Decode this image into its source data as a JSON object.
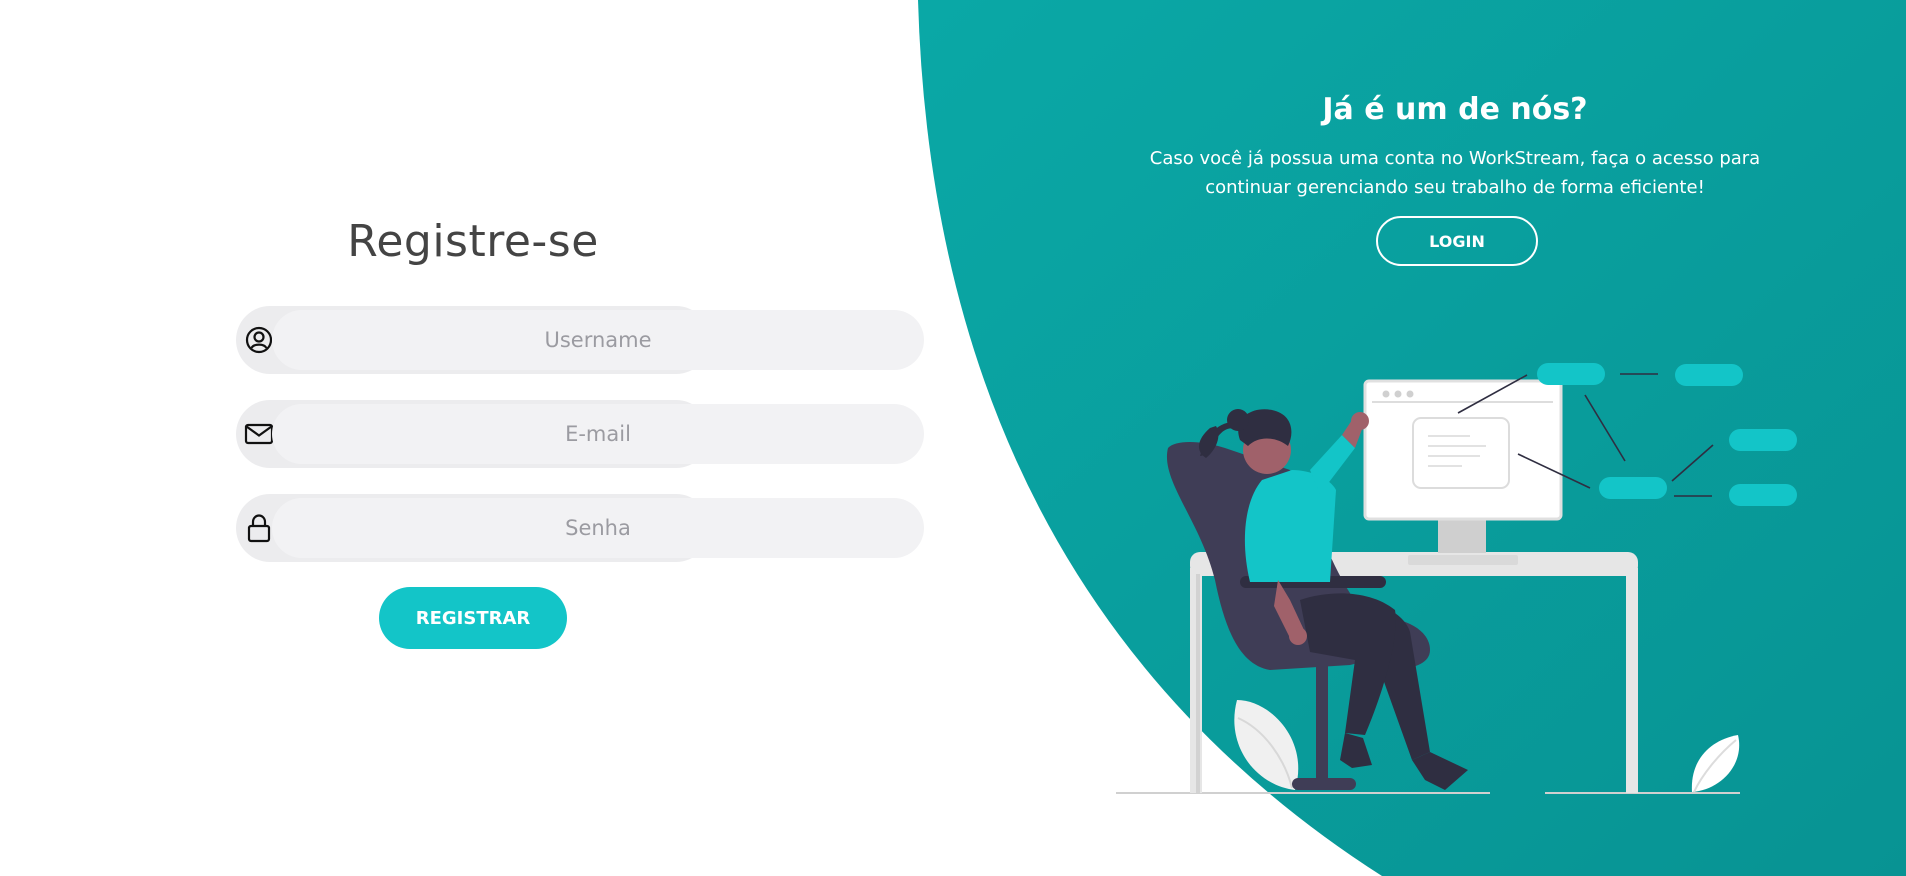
{
  "register": {
    "title": "Registre-se",
    "fields": [
      {
        "icon": "user-circle-icon",
        "placeholder": "Username",
        "value": ""
      },
      {
        "icon": "envelope-icon",
        "placeholder": "E-mail",
        "value": ""
      },
      {
        "icon": "lock-icon",
        "placeholder": "Senha",
        "value": ""
      }
    ],
    "button_label": "REGISTRAR"
  },
  "panel": {
    "title": "Já é um de nós?",
    "text": "Caso você já possua uma conta no WorkStream, faça o acesso para continuar gerenciando seu trabalho de forma eficiente!",
    "button_label": "LOGIN"
  },
  "colors": {
    "accent": "#13c5c8",
    "panel": "#0b9c9c",
    "panel_light": "#0aa6a6",
    "text_dark": "#444444",
    "chair": "#3f3d56",
    "skin": "#a0616a"
  }
}
